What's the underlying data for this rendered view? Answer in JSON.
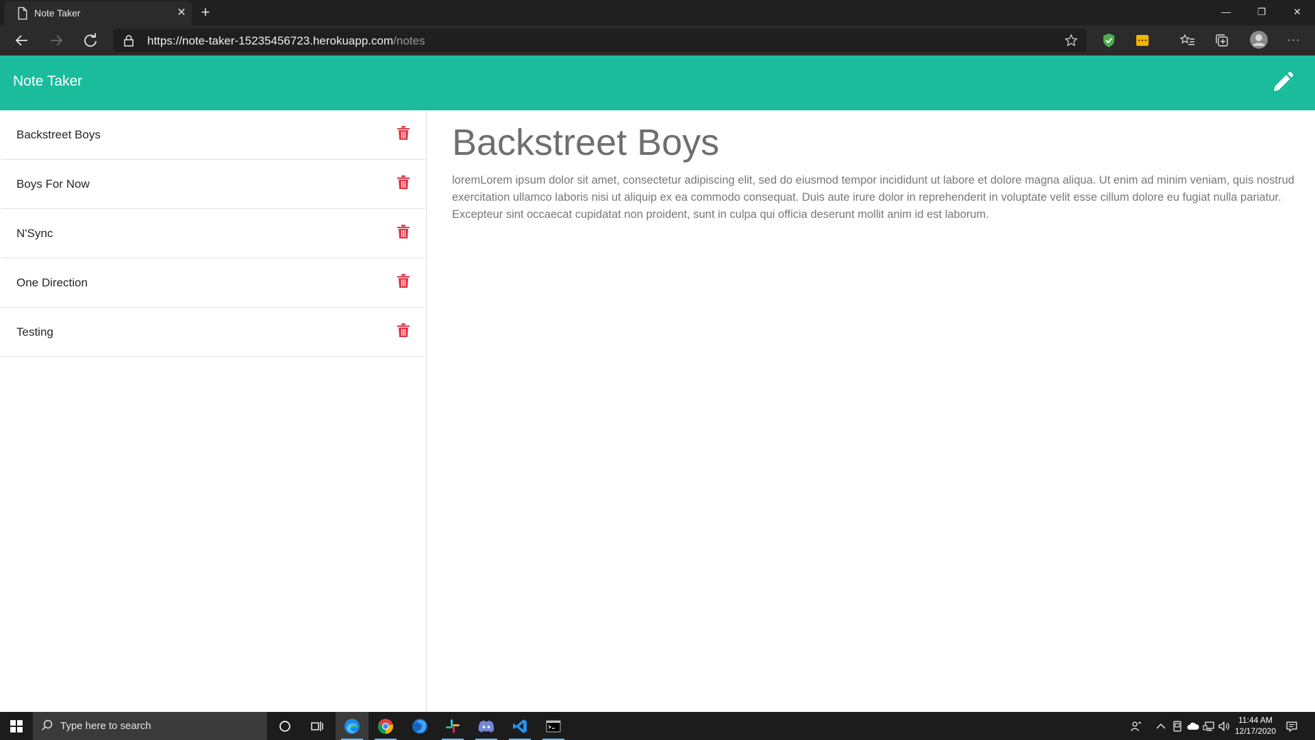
{
  "browser": {
    "tab_title": "Note Taker",
    "url_host": "https://note-taker-15235456723.herokuapp.com",
    "url_path": "/notes"
  },
  "app": {
    "title": "Note Taker"
  },
  "notes": [
    {
      "title": "Backstreet Boys"
    },
    {
      "title": "Boys For Now"
    },
    {
      "title": "N'Sync"
    },
    {
      "title": "One Direction"
    },
    {
      "title": "Testing"
    }
  ],
  "active_note": {
    "title": "Backstreet Boys",
    "text": "loremLorem ipsum dolor sit amet, consectetur adipiscing elit, sed do eiusmod tempor incididunt ut labore et dolore magna aliqua. Ut enim ad minim veniam, quis nostrud exercitation ullamco laboris nisi ut aliquip ex ea commodo consequat. Duis aute irure dolor in reprehenderit in voluptate velit esse cillum dolore eu fugiat nulla pariatur. Excepteur sint occaecat cupidatat non proident, sunt in culpa qui officia deserunt mollit anim id est laborum."
  },
  "taskbar": {
    "search_placeholder": "Type here to search",
    "time": "11:44 AM",
    "date": "12/17/2020"
  },
  "colors": {
    "header": "#1abc9c",
    "trash": "#dc3545"
  }
}
